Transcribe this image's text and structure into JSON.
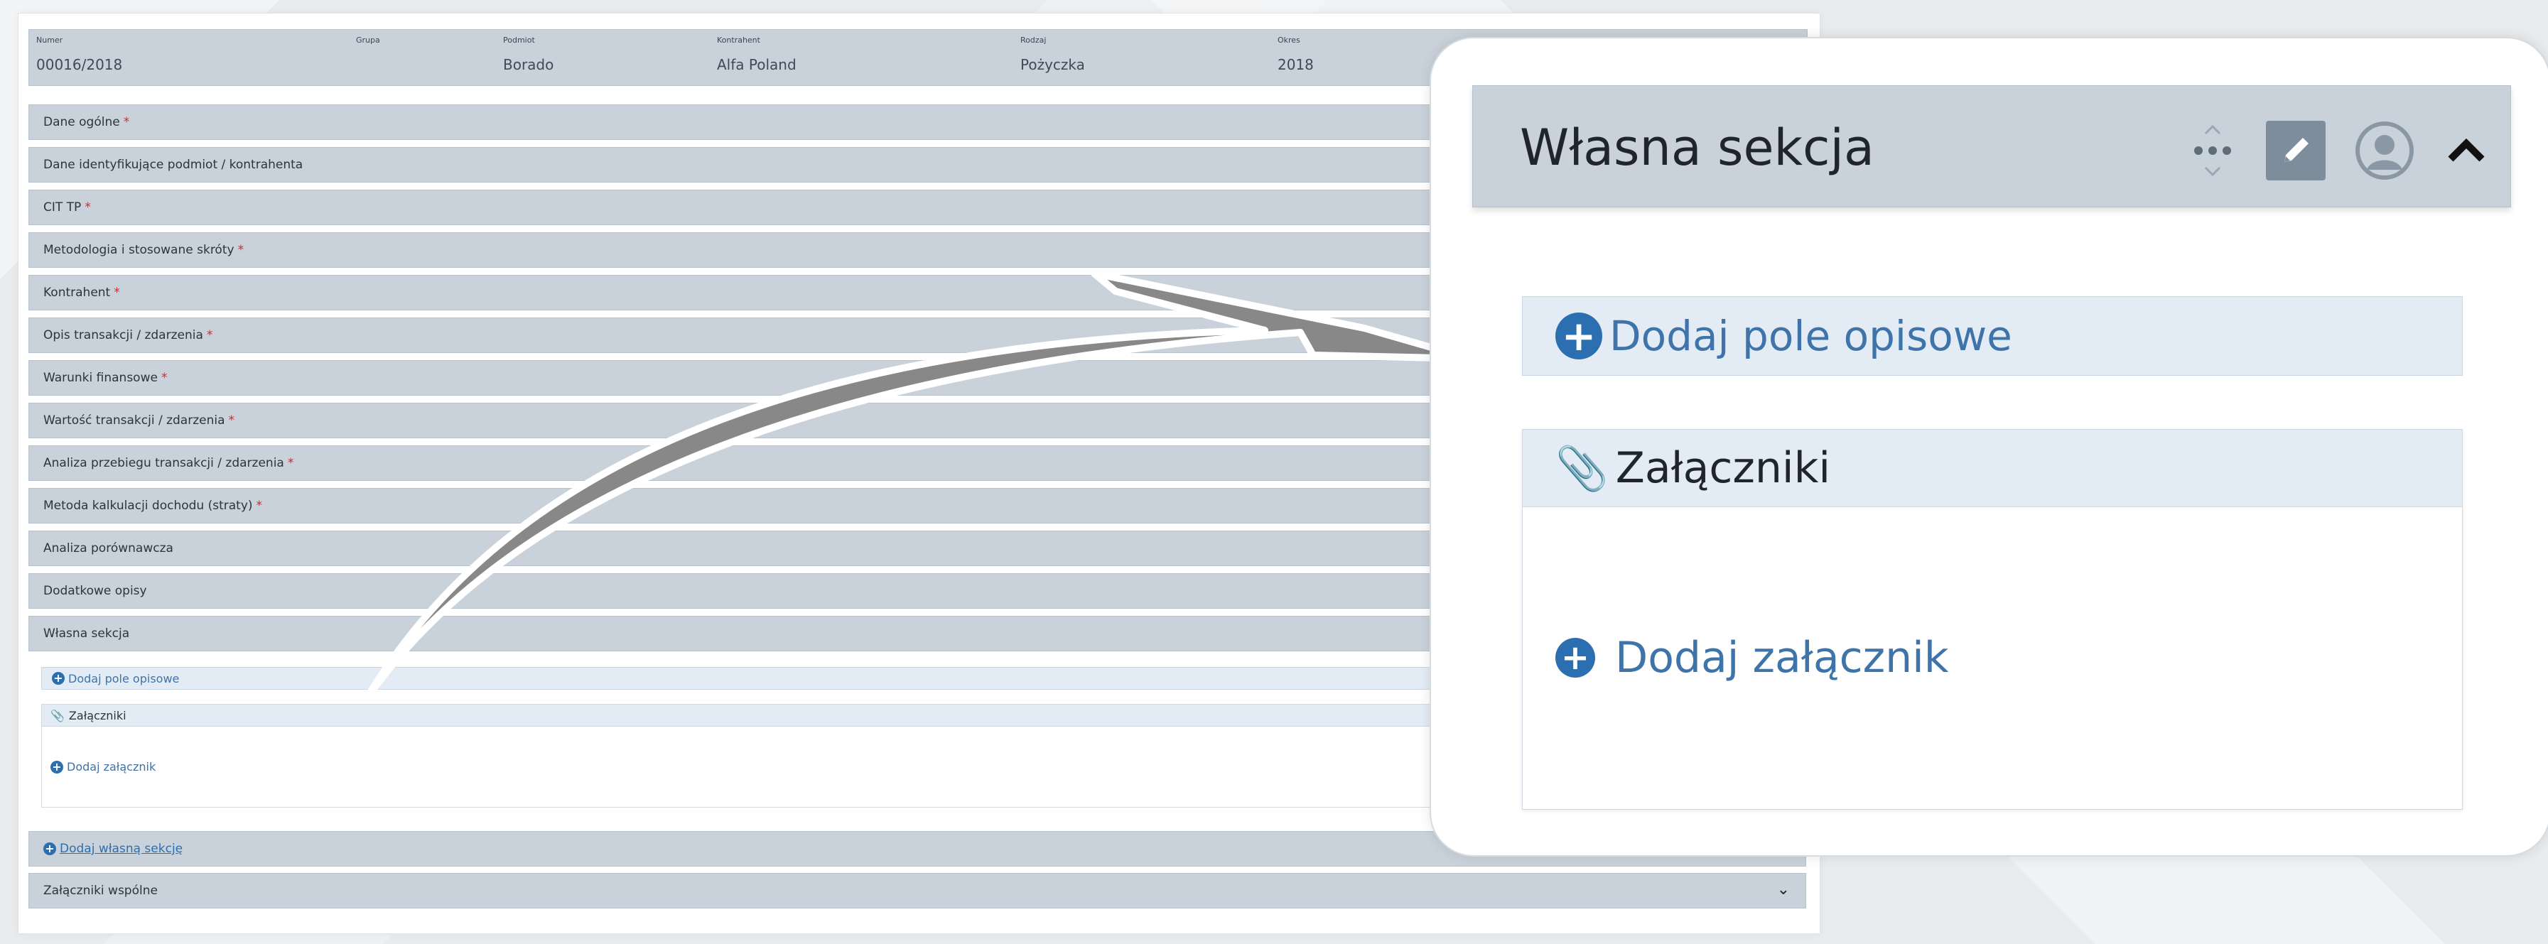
{
  "header": {
    "columns": [
      {
        "label": "Numer",
        "value": "00016/2018"
      },
      {
        "label": "Grupa",
        "value": ""
      },
      {
        "label": "Podmiot",
        "value": "Borado"
      },
      {
        "label": "Kontrahent",
        "value": "Alfa Poland"
      },
      {
        "label": "Rodzaj",
        "value": "Pożyczka"
      },
      {
        "label": "Okres",
        "value": "2018"
      }
    ]
  },
  "sections": [
    {
      "label": "Dane ogólne",
      "req": "*"
    },
    {
      "label": "Dane identyfikujące podmiot / kontrahenta",
      "req": ""
    },
    {
      "label": "CIT TP",
      "req": "*"
    },
    {
      "label": "Metodologia i stosowane skróty",
      "req": "*"
    },
    {
      "label": "Kontrahent",
      "req": "*"
    },
    {
      "label": "Opis transakcji / zdarzenia",
      "req": "*"
    },
    {
      "label": "Warunki finansowe",
      "req": "*"
    },
    {
      "label": "Wartość transakcji / zdarzenia",
      "req": "*"
    },
    {
      "label": "Analiza przebiegu transakcji / zdarzenia",
      "req": "*"
    },
    {
      "label": "Metoda kalkulacji dochodu (straty)",
      "req": "*"
    },
    {
      "label": "Analiza porównawcza",
      "req": ""
    },
    {
      "label": "Dodatkowe opisy",
      "req": ""
    },
    {
      "label": "Własna sekcja",
      "req": ""
    }
  ],
  "custom_section": {
    "add_field": "Dodaj pole opisowe",
    "attachments_title": "Załączniki",
    "add_attachment": "Dodaj załącznik"
  },
  "add_own_section": "Dodaj własną sekcję",
  "shared_attachments": "Załączniki wspólne",
  "zoom": {
    "title": "Własna sekcja",
    "add_field": "Dodaj pole opisowe",
    "attachments_title": "Załączniki",
    "add_attachment": "Dodaj załącznik",
    "icons": [
      "move-icon",
      "edit-icon",
      "user-icon",
      "chevron-up-icon"
    ]
  },
  "colors": {
    "bar": "#c9d2db",
    "link": "#3e74a9",
    "required": "#d9242b",
    "light_bar": "#e3ecf4"
  }
}
